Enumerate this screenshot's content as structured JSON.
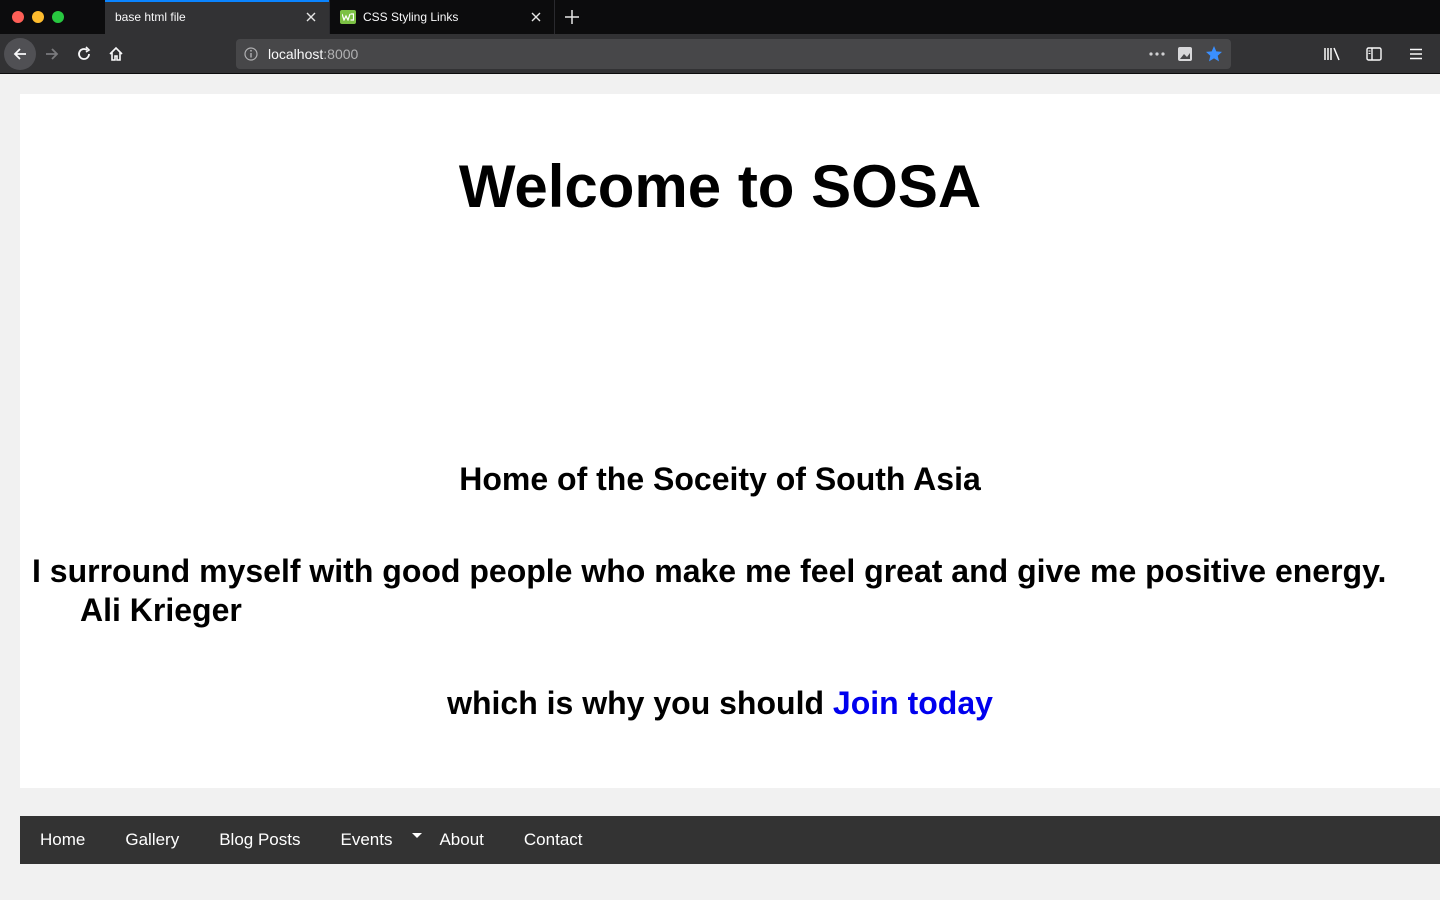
{
  "browser": {
    "tabs": [
      {
        "label": "base html file",
        "active": true
      },
      {
        "label": "CSS Styling Links",
        "active": false
      }
    ],
    "url": {
      "host": "localhost",
      "port": ":8000"
    },
    "icons": {
      "back": "arrow-left-icon",
      "forward": "arrow-right-icon",
      "reload": "reload-icon",
      "home": "home-icon",
      "info": "info-icon",
      "more": "more-icon",
      "screenshot": "screenshot-icon",
      "bookmark": "star-icon",
      "library": "library-icon",
      "sidebar": "sidebar-icon",
      "menu": "hamburger-menu-icon"
    },
    "accent_color": "#0a84ff"
  },
  "page": {
    "title": "Welcome to SOSA",
    "subtitle": "Home of the Soceity of South Asia",
    "quote": "I surround myself with good people who make me feel great and give me positive energy.",
    "author": "Ali Krieger",
    "join_prefix": "which is why you should",
    "join_link": "Join today",
    "link_color": "#0000ee"
  },
  "nav": {
    "items": [
      "Home",
      "Gallery",
      "Blog Posts",
      "Events",
      "About",
      "Contact"
    ],
    "background": "#333333"
  }
}
